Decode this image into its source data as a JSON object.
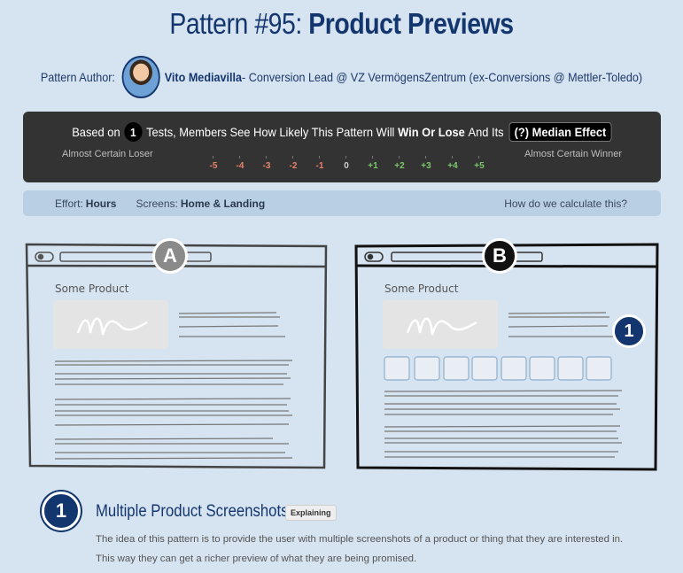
{
  "header": {
    "title_prefix": "Pattern #95: ",
    "title_name": "Product Previews"
  },
  "author": {
    "label": "Pattern Author:",
    "name": "Vito Mediavilla",
    "role": " - Conversion Lead @ VZ VermögensZentrum (ex-Conversions @ Mettler-Toledo)"
  },
  "stats_bar": {
    "based_on": "Based on",
    "test_count": "1",
    "mid_text": "Tests, Members See How Likely This Pattern Will",
    "win_or_lose": "Win Or Lose",
    "and_its": "And Its",
    "median_label": "(?) Median Effect",
    "loser_label": "Almost Certain Loser",
    "winner_label": "Almost Certain Winner",
    "scale": [
      {
        "label": "-5",
        "color": "#e8836a"
      },
      {
        "label": "-4",
        "color": "#e8836a"
      },
      {
        "label": "-3",
        "color": "#e8836a"
      },
      {
        "label": "-2",
        "color": "#e8836a"
      },
      {
        "label": "-1",
        "color": "#e8836a"
      },
      {
        "label": "0",
        "color": "#cfcfcf"
      },
      {
        "label": "+1",
        "color": "#7cc96c"
      },
      {
        "label": "+2",
        "color": "#7cc96c"
      },
      {
        "label": "+3",
        "color": "#7cc96c"
      },
      {
        "label": "+4",
        "color": "#7cc96c"
      },
      {
        "label": "+5",
        "color": "#7cc96c"
      }
    ]
  },
  "info_bar": {
    "effort_label": "Effort:",
    "effort_value": "Hours",
    "screens_label": "Screens:",
    "screens_value": "Home & Landing",
    "calc_link": "How do we calculate this?"
  },
  "variants": {
    "a": {
      "badge": "A",
      "product_label": "Some Product",
      "badge_color": "#8a8a8a"
    },
    "b": {
      "badge": "B",
      "product_label": "Some Product",
      "badge_color": "#111111",
      "marker": "1"
    }
  },
  "explanation": {
    "number": "1",
    "title": "Multiple Product Screenshots",
    "tag": "Explaining",
    "text": "The idea of this pattern is to provide the user with multiple screenshots of a product or thing that they are interested in. This way they can get a richer preview of what they are being promised."
  },
  "colors": {
    "background": "#d6e3f0",
    "brand_navy": "#14366e",
    "stats_bar": "#333333",
    "info_bar": "#b9cfe4"
  }
}
